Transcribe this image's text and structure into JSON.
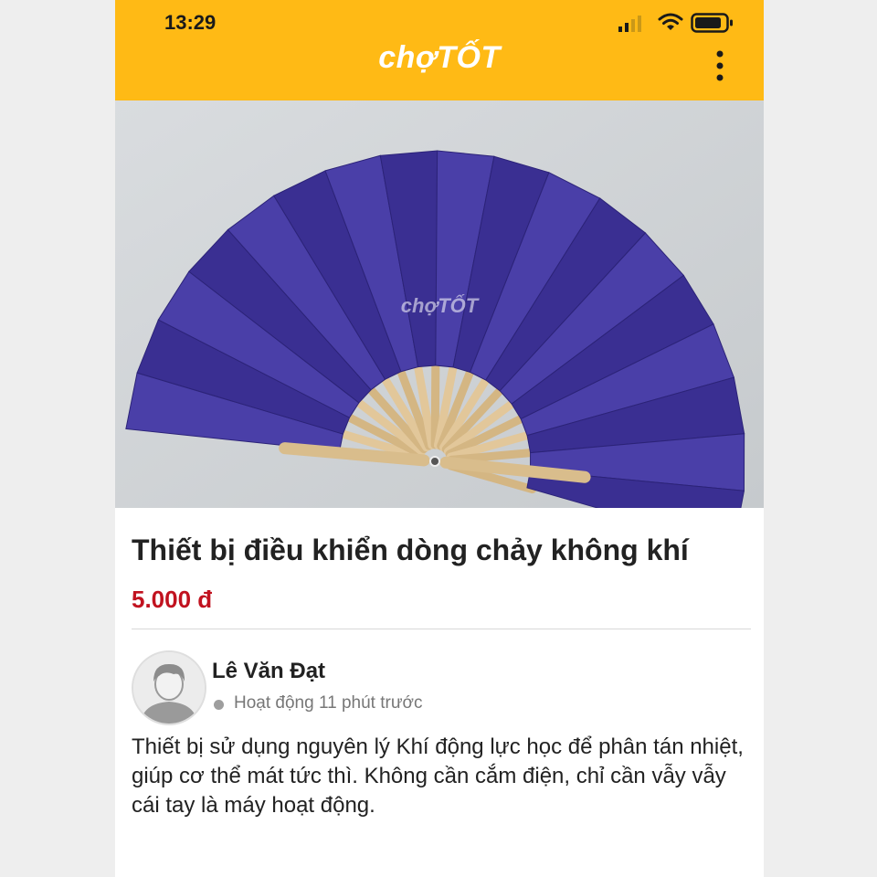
{
  "status_bar": {
    "time": "13:29"
  },
  "header": {
    "logo_text": "chợTỐT",
    "brand_color": "#ffba15"
  },
  "listing": {
    "image_subject": "folding-hand-fan-photo",
    "watermark": "chợTỐT",
    "title": "Thiết bị điều khiển dòng chảy không khí",
    "price": "5.000 đ",
    "price_color": "#c1121f"
  },
  "seller": {
    "name": "Lê Văn Đạt",
    "status": "Hoạt động 11 phút trước"
  },
  "description": "Thiết bị sử dụng nguyên lý Khí động lực học để phân tán nhiệt, giúp cơ thể mát tức thì. Không cần cắm điện, chỉ cần vẫy vẫy cái tay là máy hoạt động."
}
